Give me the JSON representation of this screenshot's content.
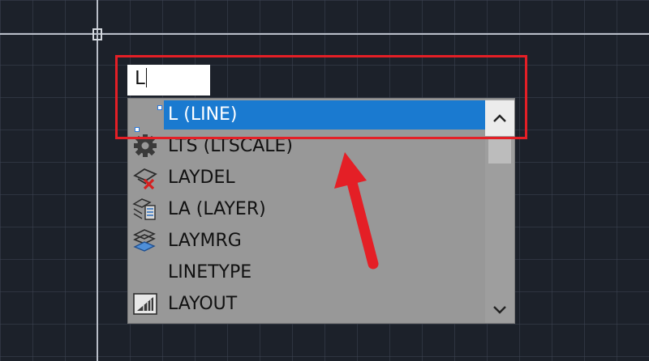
{
  "command_line": {
    "input_value": "L"
  },
  "autocomplete": {
    "items": [
      {
        "label": "L (LINE)",
        "icon": "line-icon",
        "selected": true
      },
      {
        "label": "LTS (LTSCALE)",
        "icon": "gear-icon"
      },
      {
        "label": "LAYDEL",
        "icon": "layer-delete-icon"
      },
      {
        "label": "LA (LAYER)",
        "icon": "layer-properties-icon"
      },
      {
        "label": "LAYMRG",
        "icon": "layer-merge-icon"
      },
      {
        "label": "LINETYPE",
        "icon": ""
      },
      {
        "label": "LAYOUT",
        "icon": "layout-icon"
      }
    ]
  },
  "colors": {
    "selection": "#1a7ad0",
    "annotation_red": "#e41f26",
    "viewport_bg": "#1c212a"
  }
}
